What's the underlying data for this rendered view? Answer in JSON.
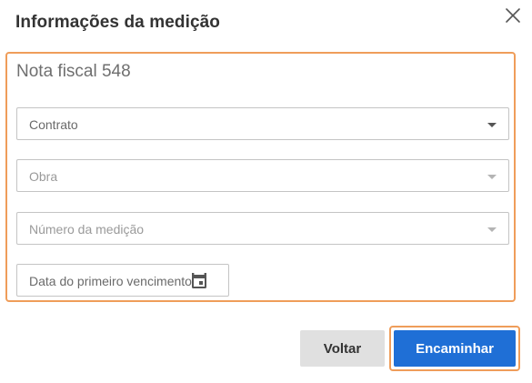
{
  "dialog": {
    "title": "Informações da medição",
    "close_icon": "close-icon"
  },
  "panel": {
    "heading": "Nota fiscal 548",
    "fields": {
      "contrato": {
        "label": "Contrato",
        "enabled": true
      },
      "obra": {
        "label": "Obra",
        "enabled": false
      },
      "numero_medicao": {
        "label": "Número da medição",
        "enabled": false
      },
      "data_vencimento": {
        "label": "Data do primeiro vencimento",
        "icon": "calendar-icon"
      }
    }
  },
  "actions": {
    "back_label": "Voltar",
    "forward_label": "Encaminhar"
  },
  "colors": {
    "highlight_border": "#ef9d5a",
    "primary_button": "#1f6fd6",
    "secondary_button": "#e0e0e0"
  }
}
